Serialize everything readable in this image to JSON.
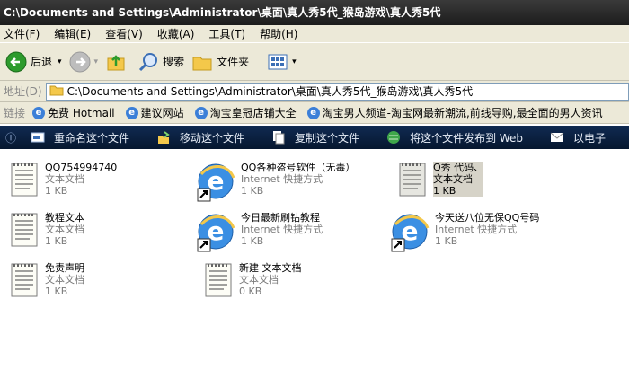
{
  "window": {
    "title": "C:\\Documents and Settings\\Administrator\\桌面\\真人秀5代_猴岛游戏\\真人秀5代"
  },
  "menu": [
    "文件(F)",
    "编辑(E)",
    "查看(V)",
    "收藏(A)",
    "工具(T)",
    "帮助(H)"
  ],
  "toolbar": {
    "back": "后退",
    "search": "搜索",
    "folders": "文件夹"
  },
  "address": {
    "label": "地址(D)",
    "value": "C:\\Documents and Settings\\Administrator\\桌面\\真人秀5代_猴岛游戏\\真人秀5代"
  },
  "links": {
    "label": "链接",
    "items": [
      "免费 Hotmail",
      "建议网站",
      "淘宝皇冠店铺大全",
      "淘宝男人频道-淘宝网最新潮流,前线导购,最全面的男人资讯"
    ]
  },
  "tasks": [
    "重命名这个文件",
    "移动这个文件",
    "复制这个文件",
    "将这个文件发布到 Web",
    "以电子"
  ],
  "files": [
    {
      "name": "QQ754994740",
      "type": "文本文档",
      "size": "1 KB",
      "icon": "text-file-icon"
    },
    {
      "name": "QQ各种盗号软件（无毒）",
      "type": "Internet 快捷方式",
      "size": "1 KB",
      "icon": "ie-shortcut-icon"
    },
    {
      "name": "Q秀 代码、",
      "type": "文本文档",
      "size": "1 KB",
      "icon": "text-file-icon"
    },
    {
      "name": "教程文本",
      "type": "文本文档",
      "size": "1 KB",
      "icon": "text-file-icon"
    },
    {
      "name": "今日最新刷钻教程",
      "type": "Internet 快捷方式",
      "size": "1 KB",
      "icon": "ie-shortcut-icon"
    },
    {
      "name": "今天送八位无保QQ号码",
      "type": "Internet 快捷方式",
      "size": "1 KB",
      "icon": "ie-shortcut-icon"
    },
    {
      "name": "免责声明",
      "type": "文本文档",
      "size": "1 KB",
      "icon": "text-file-icon"
    },
    {
      "name": "新建 文本文档",
      "type": "文本文档",
      "size": "0 KB",
      "icon": "text-file-icon"
    }
  ]
}
